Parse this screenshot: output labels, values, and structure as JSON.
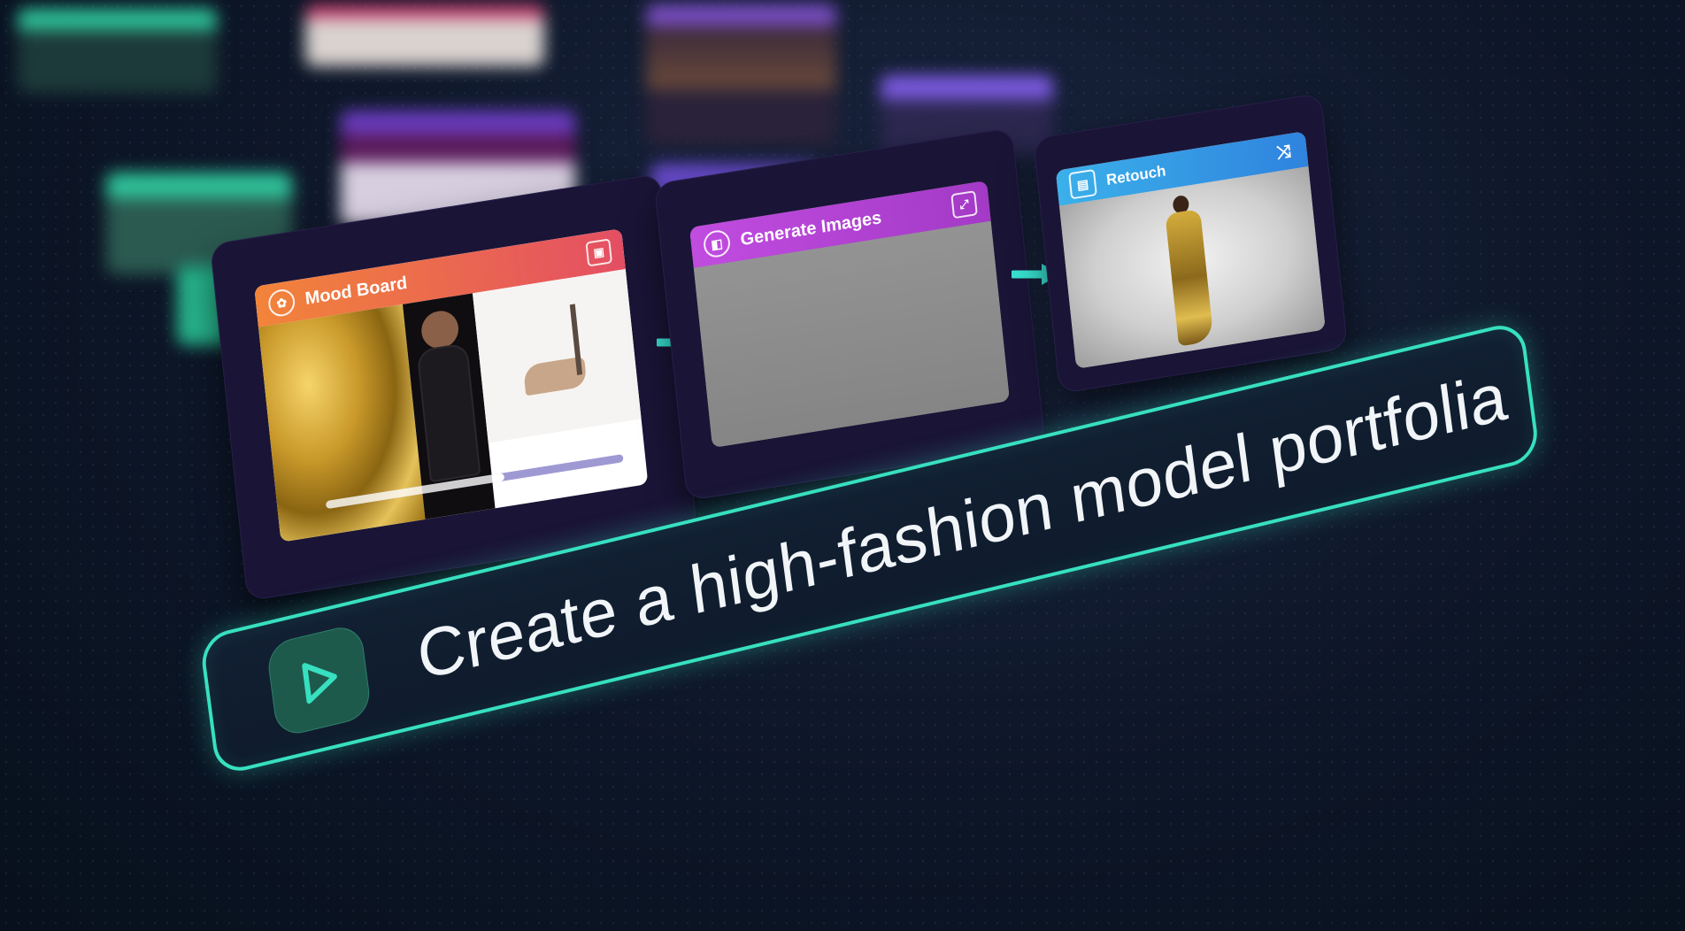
{
  "nodes": [
    {
      "id": "mood-board",
      "title": "Mood Board",
      "header_color": "#f06a43",
      "icon": "palette-icon",
      "action_icon": "save-icon",
      "progress": 0.6
    },
    {
      "id": "generate-images",
      "title": "Generate Images",
      "header_color": "#b34ad6",
      "icon": "image-stack-icon",
      "action_icon": "expand-icon"
    },
    {
      "id": "retouch",
      "title": "Retouch",
      "header_color": "#3598e6",
      "icon": "document-icon",
      "action_icon": "shuffle-icon"
    }
  ],
  "prompt": {
    "text": "Create a high-fashion model portfolia",
    "accent_color": "#37e0c0",
    "play_icon": "play-icon"
  }
}
